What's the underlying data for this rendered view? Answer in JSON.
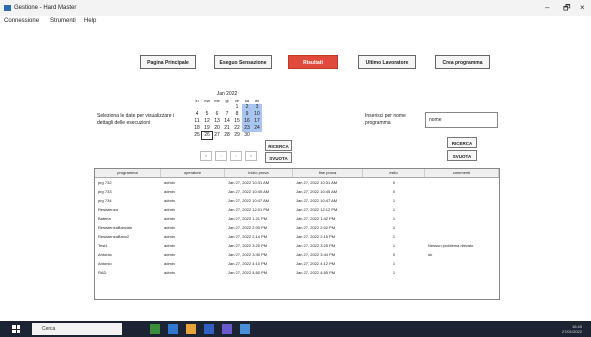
{
  "window": {
    "title": "Gestione - Hard Master",
    "minimize": "–",
    "maximize": "🗗",
    "close": "×"
  },
  "menu": [
    "Connessione",
    "Strumenti",
    "Help"
  ],
  "nav": [
    {
      "label": "Pagina Principale"
    },
    {
      "label": "Eseguo Sensazione"
    },
    {
      "label": "Risultati",
      "active": true
    },
    {
      "label": "Ultimo Lavoratore"
    },
    {
      "label": "Crea programma"
    }
  ],
  "calendar": {
    "title": "Jan 2022",
    "weekdays": [
      "lu",
      "ma",
      "me",
      "gi",
      "ve",
      "sa",
      "do"
    ],
    "weeks": [
      [
        "",
        "",
        "",
        "",
        "1",
        "2",
        "3"
      ],
      [
        "4",
        "5",
        "6",
        "7",
        "8",
        "9",
        "10"
      ],
      [
        "11",
        "12",
        "13",
        "14",
        "15",
        "16",
        "17"
      ],
      [
        "18",
        "19",
        "20",
        "21",
        "22",
        "23",
        "24"
      ],
      [
        "25",
        "26",
        "27",
        "28",
        "29",
        "30",
        ""
      ]
    ],
    "selected": [
      "2",
      "3",
      "9",
      "10",
      "16",
      "17",
      "23",
      "24"
    ],
    "today": "26",
    "nav": [
      "«",
      "‹",
      "›",
      "»"
    ]
  },
  "left": {
    "instructions": "Seleziona le date per visualizzare i dettagli delle esecuzioni",
    "search_label": "RICERCA",
    "show_label": "SVUOTA"
  },
  "right": {
    "label": "Inserisci per nome programma",
    "input_value": "nome",
    "search_label": "RICERCA",
    "show_label": "SVUOTA"
  },
  "table": {
    "columns": [
      "programma",
      "operatore",
      "inizio prova",
      "fine prova",
      "esito",
      "commenti"
    ],
    "rows": [
      [
        "prg 732",
        "admin",
        "Jan 27, 2022 10:31 AM",
        "Jan 27, 2022 10:31 AM",
        "0",
        ""
      ],
      [
        "prg 733",
        "admin",
        "Jan 27, 2022 10:45 AM",
        "Jan 27, 2022 10:45 AM",
        "0",
        ""
      ],
      [
        "prg 734",
        "admin",
        "Jan 27, 2022 10:47 AM",
        "Jan 27, 2022 10:47 AM",
        "1",
        ""
      ],
      [
        "Resistenza",
        "admin",
        "Jan 27, 2022 12:01 PM",
        "Jan 27, 2022 12:12 PM",
        "1",
        ""
      ],
      [
        "Bateria",
        "admin",
        "Jan 27, 2022 1:21 PM",
        "Jan 27, 2022 1:42 PM",
        "1",
        ""
      ],
      [
        "ResistenzaBancale",
        "admin",
        "Jan 27, 2022 2:00 PM",
        "Jan 27, 2022 2:02 PM",
        "1",
        ""
      ],
      [
        "ResistenzaBanc2",
        "admin",
        "Jan 27, 2022 2:14 PM",
        "Jan 27, 2022 2:15 PM",
        "1",
        ""
      ],
      [
        "Test1",
        "admin",
        "Jan 27, 2022 3:20 PM",
        "Jan 27, 2022 3:25 PM",
        "1",
        "Nessun problema rilevato"
      ],
      [
        "Antonia",
        "admin",
        "Jan 27, 2022 3:40 PM",
        "Jan 27, 2022 3:44 PM",
        "0",
        "ok"
      ],
      [
        "Antonio",
        "admin",
        "Jan 27, 2022 4:10 PM",
        "Jan 27, 2022 4:12 PM",
        "1",
        ""
      ],
      [
        "RAD",
        "admin",
        "Jan 27, 2022 4:50 PM",
        "Jan 27, 2022 4:55 PM",
        "1",
        ""
      ]
    ]
  },
  "taskbar": {
    "search_placeholder": "Cerca",
    "time": "16:45",
    "date": "27/01/2022"
  },
  "colors": {
    "active_tab": "#e04a3a",
    "calendar_selected": "#a9c6f0",
    "taskbar": "#1c2433"
  }
}
